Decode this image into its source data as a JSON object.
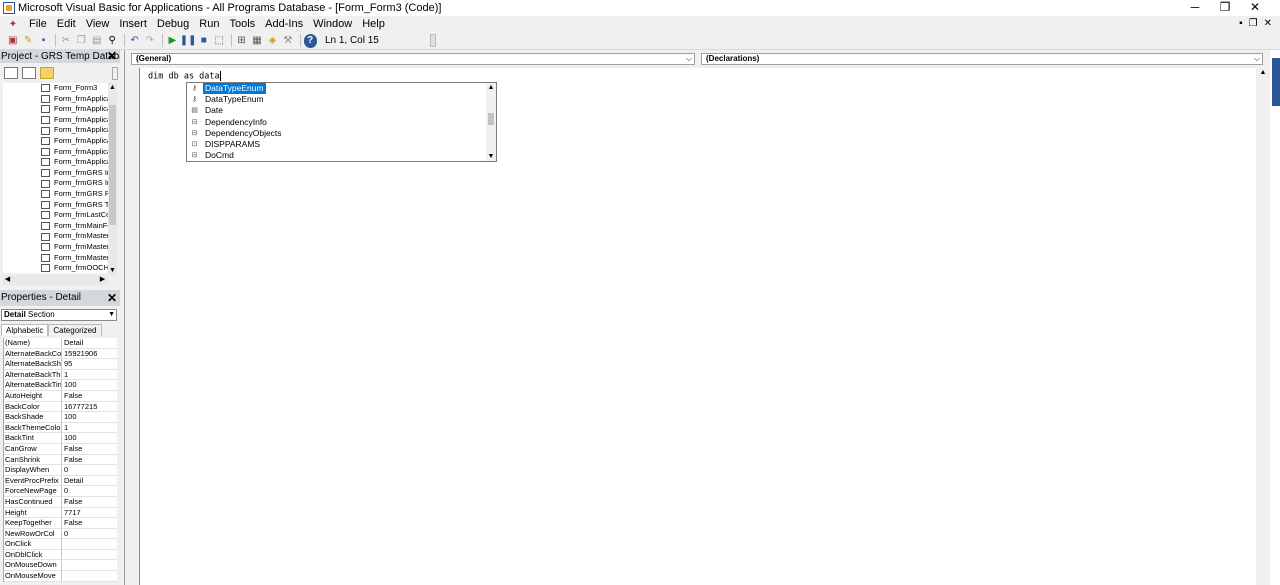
{
  "window": {
    "title": "Microsoft Visual Basic for Applications - All Programs Database - [Form_Form3 (Code)]",
    "minimize": "─",
    "restore": "❐",
    "close": "✕"
  },
  "menubar": {
    "items": [
      "File",
      "Edit",
      "View",
      "Insert",
      "Debug",
      "Run",
      "Tools",
      "Add-Ins",
      "Window",
      "Help"
    ],
    "mdi_min": "▪",
    "mdi_restore": "❐",
    "mdi_close": "✕"
  },
  "toolbar": {
    "status": "Ln 1, Col 15",
    "icons": [
      "view-access-icon",
      "insert-module-icon",
      "save-icon",
      "cut-icon",
      "copy-icon",
      "paste-icon",
      "find-icon",
      "undo-icon",
      "redo-icon",
      "run-icon",
      "break-icon",
      "reset-icon",
      "design-mode-icon",
      "project-explorer-icon",
      "properties-icon",
      "object-browser-icon",
      "toolbox-icon",
      "help-icon"
    ]
  },
  "project_pane": {
    "title": "Project - GRS Temp Database",
    "items": [
      "Form_Form3",
      "Form_frmApplica",
      "Form_frmApplica",
      "Form_frmApplica",
      "Form_frmApplica",
      "Form_frmApplica",
      "Form_frmApplica",
      "Form_frmApplica",
      "Form_frmGRS In",
      "Form_frmGRS In",
      "Form_frmGRS Pa",
      "Form_frmGRS Tr",
      "Form_frmLastCo",
      "Form_frmMainFo",
      "Form_frmMaster",
      "Form_frmMaster",
      "Form_frmMaster",
      "Form_frmOOCHS"
    ]
  },
  "properties_pane": {
    "title": "Properties - Detail",
    "object_name": "Detail",
    "object_type": "Section",
    "tabs": [
      "Alphabetic",
      "Categorized"
    ],
    "rows": [
      {
        "name": "(Name)",
        "value": "Detail"
      },
      {
        "name": "AlternateBackColo",
        "value": "15921906"
      },
      {
        "name": "AlternateBackSha",
        "value": "95"
      },
      {
        "name": "AlternateBackThe",
        "value": "1"
      },
      {
        "name": "AlternateBackTint",
        "value": "100"
      },
      {
        "name": "AutoHeight",
        "value": "False"
      },
      {
        "name": "BackColor",
        "value": "16777215"
      },
      {
        "name": "BackShade",
        "value": "100"
      },
      {
        "name": "BackThemeColorIr",
        "value": "1"
      },
      {
        "name": "BackTint",
        "value": "100"
      },
      {
        "name": "CanGrow",
        "value": "False"
      },
      {
        "name": "CanShrink",
        "value": "False"
      },
      {
        "name": "DisplayWhen",
        "value": "0"
      },
      {
        "name": "EventProcPrefix",
        "value": "Detail"
      },
      {
        "name": "ForceNewPage",
        "value": "0"
      },
      {
        "name": "HasContinued",
        "value": "False"
      },
      {
        "name": "Height",
        "value": "7717"
      },
      {
        "name": "KeepTogether",
        "value": "False"
      },
      {
        "name": "NewRowOrCol",
        "value": "0"
      },
      {
        "name": "OnClick",
        "value": ""
      },
      {
        "name": "OnDblClick",
        "value": ""
      },
      {
        "name": "OnMouseDown",
        "value": ""
      },
      {
        "name": "OnMouseMove",
        "value": ""
      }
    ]
  },
  "code_window": {
    "object_combo": "(General)",
    "proc_combo": "(Declarations)",
    "code_line": "dim db as data"
  },
  "autocomplete": {
    "items": [
      {
        "label": "DataTypeEnum",
        "icon": "enum-icon",
        "selected": true
      },
      {
        "label": "DataTypeEnum",
        "icon": "enum-icon",
        "selected": false
      },
      {
        "label": "Date",
        "icon": "module-icon",
        "selected": false
      },
      {
        "label": "DependencyInfo",
        "icon": "class-icon",
        "selected": false
      },
      {
        "label": "DependencyObjects",
        "icon": "class-icon",
        "selected": false
      },
      {
        "label": "DISPPARAMS",
        "icon": "type-icon",
        "selected": false
      },
      {
        "label": "DoCmd",
        "icon": "class-icon",
        "selected": false
      }
    ]
  },
  "colors": {
    "selection": "#0078d7",
    "pane_title": "#d4d8dc",
    "accent": "#2b5797"
  }
}
